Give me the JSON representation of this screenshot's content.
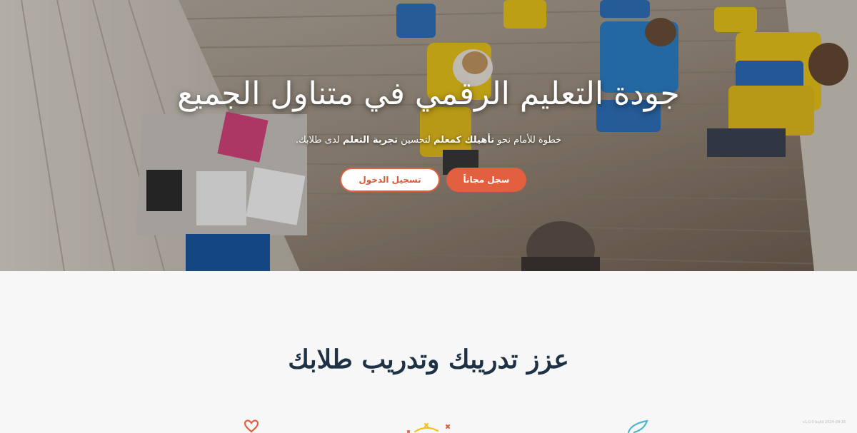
{
  "hero": {
    "title": "جودة التعليم الرقمي في متناول الجميع",
    "subtitle_parts": {
      "p1": "خطوة للأمام نحو ",
      "p2": "تأهيلك كمعلم",
      "p3": " لتحسين ",
      "p4": "تجربة التعلم",
      "p5": " لدى طلابك."
    },
    "primary_cta": "سجل مجاناً",
    "secondary_cta": "تسجيل الدخول"
  },
  "section": {
    "title": "عزز تدريبك وتدريب طلابك"
  },
  "features": {
    "icons": [
      "heart-icon",
      "sparkle-icon",
      "leaf-icon"
    ]
  },
  "footer": {
    "version": "v1.0.0 build 2024-09-16"
  },
  "colors": {
    "accent": "#e2603f",
    "heading": "#1f3245",
    "teal": "#4fb8c8",
    "yellow": "#f3c21f"
  }
}
